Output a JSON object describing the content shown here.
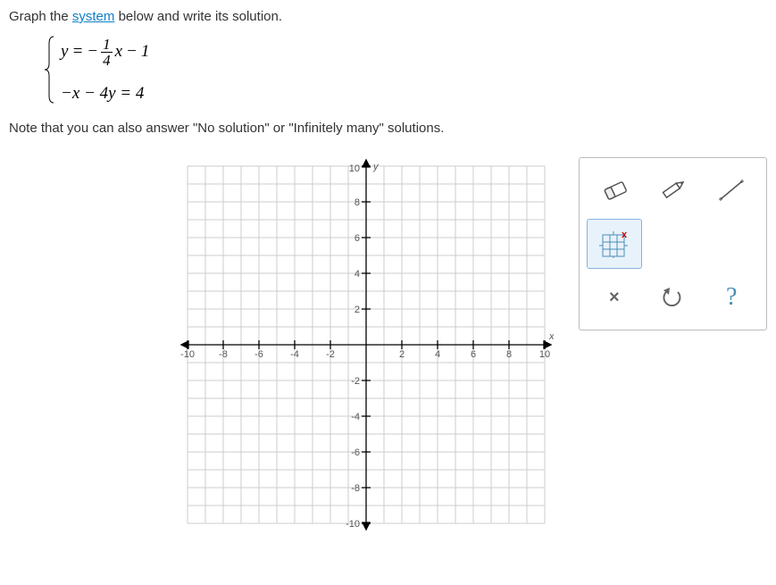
{
  "prompt": {
    "pre": "Graph the ",
    "link": "system",
    "post": " below and write its solution."
  },
  "equations": {
    "eq1": {
      "lhs": "y",
      "op1": "=",
      "neg": "−",
      "num": "1",
      "den": "4",
      "var": "x",
      "op2": "−",
      "const": "1"
    },
    "eq2": {
      "full": "−x − 4y = 4"
    }
  },
  "note": {
    "pre": "Note that you can also answer \"No solution\" or \"Infinitely many\" solutions."
  },
  "graph": {
    "xlabel": "x",
    "ylabel": "y",
    "xticks": [
      "-10",
      "-8",
      "-6",
      "-4",
      "-2",
      "2",
      "4",
      "6",
      "8",
      "10"
    ],
    "ylabels_pos": [
      "2",
      "4",
      "6",
      "8",
      "10"
    ],
    "ylabels_neg": [
      "-2",
      "-4",
      "-6",
      "-8",
      "-10"
    ]
  },
  "tools": {
    "eraser": "eraser-icon",
    "pencil": "pencil-icon",
    "line": "line-icon",
    "grid": "remove-point-icon",
    "close": "×",
    "undo": "undo-icon",
    "help": "?"
  }
}
